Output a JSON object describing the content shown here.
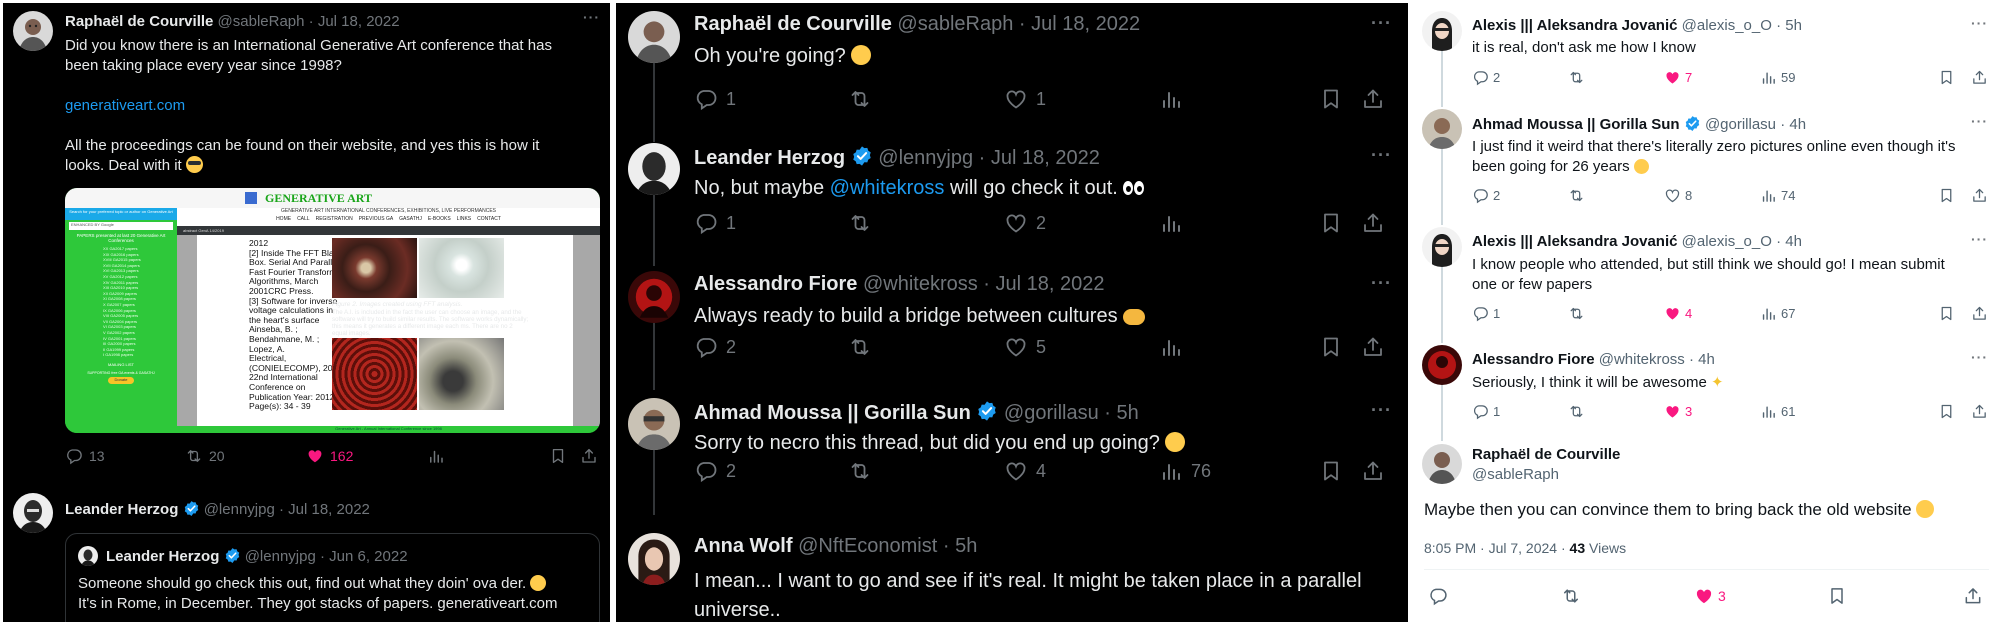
{
  "panel1": {
    "tweet": {
      "author": "Raphaël de Courville",
      "handle": "@sableRaph",
      "sep": "·",
      "date": "Jul 18, 2022",
      "text_line1": "Did you know there is an International Generative Art conference that has",
      "text_line2": "been taking place every year since 1998?",
      "link": "generativeart.com",
      "text_line3": "All the proceedings can be found on their website, and yes this is how it",
      "text_line4": "looks. Deal with it",
      "counts": {
        "replies": "13",
        "retweets": "20",
        "likes": "162"
      }
    },
    "website": {
      "logo_text": "GENERATIVE ART",
      "subtitle": "GENERATIVE ART INTERNATIONAL CONFERENCES, EXHIBITIONS, LIVE PERFORMANCES",
      "nav": [
        "HOME",
        "CALL",
        "REGISTRATION",
        "PREVIOUS GA",
        "GASATHJ",
        "E-BOOKS",
        "LINKS",
        "CONTACT"
      ],
      "sidebar_head": "Search for your preferred topic or author on Generative Art",
      "search_label": "ENHANCED BY Google",
      "papers_title": "PAPERS presented at last 20 Generative Art Conferences",
      "paper_links": [
        "XX GA2017 papers",
        "XIX GA2016 papers",
        "XVIII GA2015 papers",
        "XVII GA2014 papers",
        "XVI GA2013 papers",
        "XV GA2012 papers",
        "XIV GA2011 papers",
        "XIII GA2010 papers",
        "XII GA2009 papers",
        "XI GA2008 papers",
        "X GA2007 papers",
        "IX GA2006 papers",
        "VIII GA2005 papers",
        "VII GA2004 papers",
        "VI GA2003 papers",
        "V GA2002 papers",
        "IV GA2001 papers",
        "III GA2000 papers",
        "II GA1999 papers",
        "I GA1998 papers"
      ],
      "mailing": "MAILING LIST",
      "sidebar_foot": "SUPPORTING free GA events & GASATHJ",
      "donate": "Donate",
      "pdf_title": "abstract GenA 14/2019",
      "paper_text": [
        "2012",
        "[2] Inside The FFT Black",
        "Box. Serial And Parallel",
        "Fast Fourier Transform",
        "Algorithms, March",
        "2001CRC Press.",
        "[3] Software for inverse",
        "voltage calculations in",
        "the heart's surface",
        "Ainseba, B. ;",
        "Bendahmane, M. ;",
        "Lopez, A.",
        "Electrical,",
        "(CONIELECOMP), 2012",
        "22nd International",
        "Conference on",
        "Publication Year: 2012 ,",
        "Page(s): 34 - 39"
      ],
      "caption": "Figure 2. Images created using FFT analysis.",
      "caption_body": [
        "The A.I. is included in the fact the user can choose an image, and the",
        "software will try to build similar results. The software works dynamically;",
        "this means it generates a different image each ms. There are no 2",
        "equal images."
      ],
      "footer": "Generative Art - Annual International Conference since 1998"
    },
    "reply": {
      "author": "Leander Herzog",
      "handle": "@lennyjpg",
      "sep": "·",
      "date": "Jul 18, 2022"
    },
    "quote": {
      "author": "Leander Herzog",
      "handle": "@lennyjpg",
      "sep": "·",
      "date": "Jun 6, 2022",
      "text_line1": "Someone should go check this out, find out what they doin' ova der.",
      "text_line2": "It's in Rome, in December. They got stacks of papers. generativeart.com"
    }
  },
  "panel2": {
    "tweets": [
      {
        "author": "Raphaël de Courville",
        "handle": "@sableRaph",
        "sep": "·",
        "date": "Jul 18, 2022",
        "text": "Oh you're going?",
        "replies": "1",
        "retweets": "",
        "likes": "1",
        "views": ""
      },
      {
        "author": "Leander Herzog",
        "handle": "@lennyjpg",
        "sep": "·",
        "date": "Jul 18, 2022",
        "text_pre": "No, but maybe ",
        "mention": "@whitekross",
        "text_post": " will go check it out.",
        "replies": "1",
        "retweets": "",
        "likes": "2",
        "views": ""
      },
      {
        "author": "Alessandro Fiore",
        "handle": "@whitekross",
        "sep": "·",
        "date": "Jul 18, 2022",
        "text": "Always ready to build a bridge between cultures",
        "replies": "2",
        "retweets": "",
        "likes": "5",
        "views": ""
      },
      {
        "author": "Ahmad Moussa || Gorilla Sun",
        "handle": "@gorillasu",
        "sep": "·",
        "date": "5h",
        "text": "Sorry to necro this thread, but did you end up going?",
        "replies": "2",
        "retweets": "",
        "likes": "4",
        "views": "76"
      },
      {
        "author": "Anna Wolf",
        "handle": "@NftEconomist",
        "sep": "·",
        "date": "5h",
        "text_line1": "I mean... I want to go and see if it's real. It might be taken place in a parallel",
        "text_line2": "universe.."
      }
    ]
  },
  "panel3": {
    "tweets": [
      {
        "author": "Alexis ||| Aleksandra Jovanić",
        "handle": "@alexis_o_O",
        "sep": "·",
        "date": "5h",
        "text": "it is real, don't ask me how I know",
        "replies": "2",
        "likes": "7",
        "views": "59"
      },
      {
        "author": "Ahmad Moussa || Gorilla Sun",
        "handle": "@gorillasu",
        "sep": "·",
        "date": "4h",
        "text_line1": "I just find it weird that there's literally zero pictures online even though it's",
        "text_line2": "been going for 26 years",
        "replies": "2",
        "likes": "8",
        "views": "74"
      },
      {
        "author": "Alexis ||| Aleksandra Jovanić",
        "handle": "@alexis_o_O",
        "sep": "·",
        "date": "4h",
        "text_line1": "I know people who attended, but still think we should go! I mean submit",
        "text_line2": "one or few papers",
        "replies": "1",
        "likes": "4",
        "views": "67"
      },
      {
        "author": "Alessandro Fiore",
        "handle": "@whitekross",
        "sep": "·",
        "date": "4h",
        "text": "Seriously, I think it will be awesome",
        "replies": "1",
        "likes": "3",
        "views": "61"
      }
    ],
    "main": {
      "author": "Raphaël de Courville",
      "handle": "@sableRaph",
      "text": "Maybe then you can convince them to bring back the old website",
      "time": "8:05 PM · Jul 7, 2024 · ",
      "views_count": "43",
      "views_label": " Views",
      "likes": "3"
    }
  },
  "colors": {
    "blue": "#1d9bf0",
    "pink": "#f91880",
    "muted_dark": "#71767b",
    "muted_light": "#536471"
  }
}
